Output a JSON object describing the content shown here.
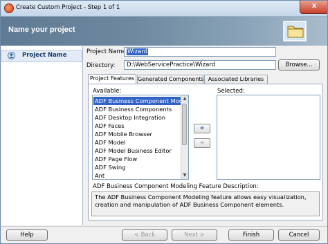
{
  "window": {
    "title": "Create Custom Project - Step 1 of 1",
    "close_glyph": "x"
  },
  "header": {
    "title": "Name your project"
  },
  "sidebar": {
    "items": [
      {
        "label": "Project Name"
      }
    ]
  },
  "form": {
    "project_name_label": "Project Name:",
    "project_name_value": "Wizard",
    "directory_label": "Directory:",
    "directory_value": "D:\\WebServicePractice\\Wizard",
    "browse_label": "Browse..."
  },
  "tabs": [
    {
      "label": "Project Features"
    },
    {
      "label": "Generated Components"
    },
    {
      "label": "Associated Libraries"
    }
  ],
  "features": {
    "available_label": "Available:",
    "selected_label": "Selected:",
    "available_items": [
      "ADF Business Component Modeling",
      "ADF Business Components",
      "ADF Desktop Integration",
      "ADF Faces",
      "ADF Mobile Browser",
      "ADF Model",
      "ADF Model Business Editor",
      "ADF Page Flow",
      "ADF Swing",
      "Ant"
    ],
    "selected_index": 0,
    "add_glyph": "»",
    "remove_glyph": "«",
    "description_label": "ADF Business Component Modeling Feature Description:",
    "description_text": "The ADF Business Component Modeling feature allows easy visualization, creation and manipulation of ADF Business Component elements."
  },
  "footer": {
    "help_label": "Help",
    "back_label": "< Back",
    "next_label": "Next >",
    "finish_label": "Finish",
    "cancel_label": "Cancel"
  },
  "colors": {
    "header_bg": "#6d889f",
    "selection": "#3163c6"
  }
}
